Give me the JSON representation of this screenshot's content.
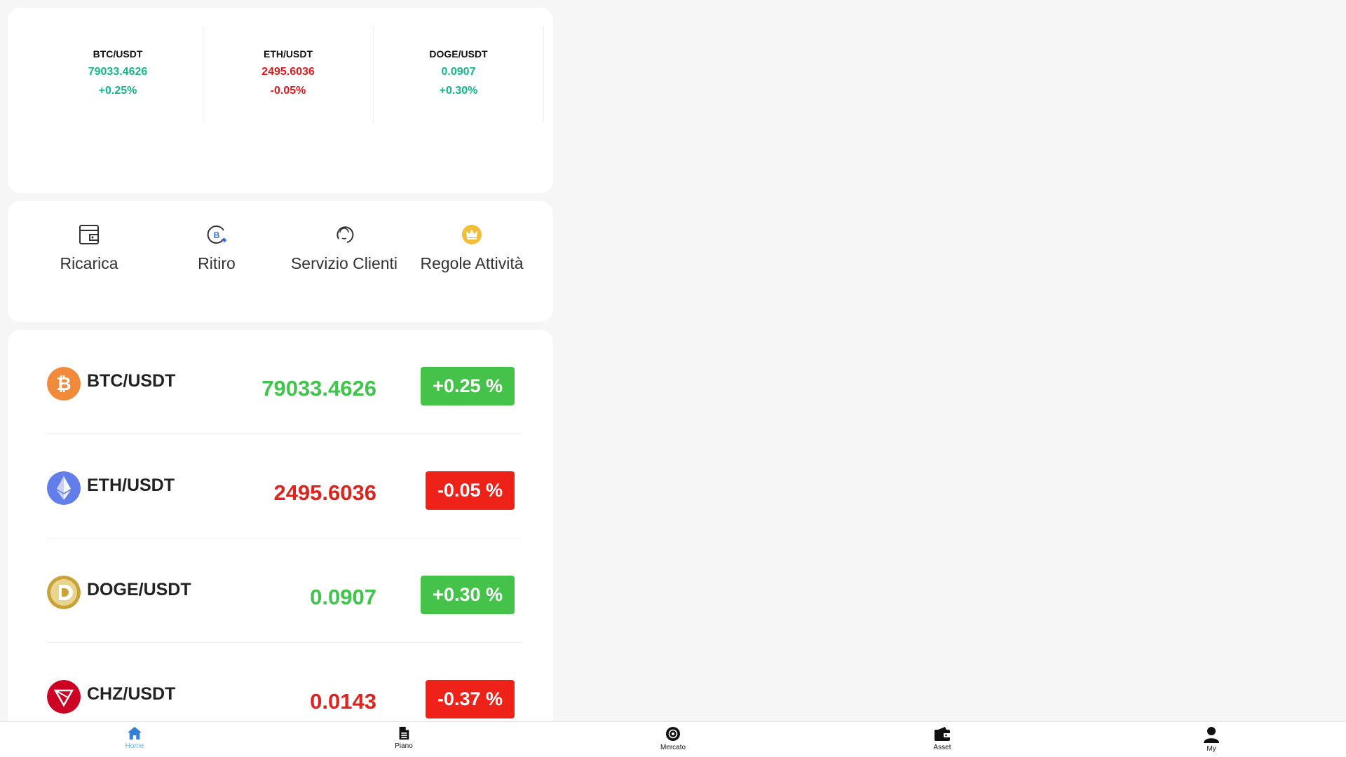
{
  "ticker": [
    {
      "pair": "BTC/USDT",
      "price": "79033.4626",
      "change": "+0.25%",
      "trend": "up"
    },
    {
      "pair": "ETH/USDT",
      "price": "2495.6036",
      "change": "-0.05%",
      "trend": "down"
    },
    {
      "pair": "DOGE/USDT",
      "price": "0.0907",
      "change": "+0.30%",
      "trend": "up"
    }
  ],
  "actions": [
    {
      "label": "Ricarica",
      "icon": "wallet-icon"
    },
    {
      "label": "Ritiro",
      "icon": "bitcoin-withdraw-icon"
    },
    {
      "label": "Servizio Clienti",
      "icon": "support-icon"
    },
    {
      "label": "Regole Attività",
      "icon": "crown-icon"
    }
  ],
  "market": [
    {
      "pair": "BTC/USDT",
      "price": "79033.4626",
      "change": "+0.25 %",
      "trend": "up",
      "icon": "bitcoin-icon"
    },
    {
      "pair": "ETH/USDT",
      "price": "2495.6036",
      "change": "-0.05 %",
      "trend": "down",
      "icon": "ethereum-icon"
    },
    {
      "pair": "DOGE/USDT",
      "price": "0.0907",
      "change": "+0.30 %",
      "trend": "up",
      "icon": "dogecoin-icon"
    },
    {
      "pair": "CHZ/USDT",
      "price": "0.0143",
      "change": "-0.37 %",
      "trend": "down",
      "icon": "chiliz-icon"
    }
  ],
  "nav": [
    {
      "label": "Home",
      "icon": "home-icon",
      "active": true
    },
    {
      "label": "Piano",
      "icon": "document-icon"
    },
    {
      "label": "Mercato",
      "icon": "market-icon"
    },
    {
      "label": "Asset",
      "icon": "wallet-icon"
    },
    {
      "label": "My",
      "icon": "user-icon"
    }
  ],
  "colors": {
    "up": "#13b88a",
    "down": "#e01a1a",
    "badge_up": "#45c24a",
    "badge_down": "#ee2219",
    "nav_active": "#6fb0e6"
  }
}
